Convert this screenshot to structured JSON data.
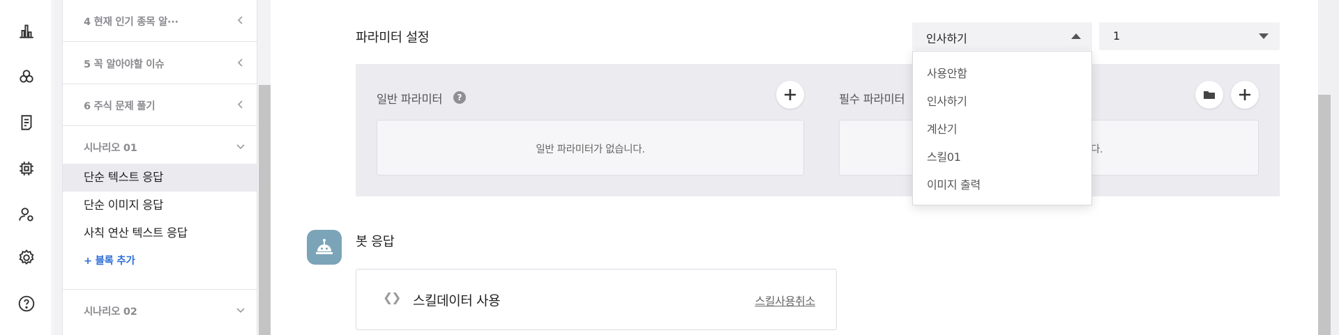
{
  "rail": {
    "icons": [
      "chart-icon",
      "shapes-icon",
      "document-icon",
      "chip-icon",
      "user-settings-icon",
      "gear-icon",
      "help-icon"
    ]
  },
  "sidebar": {
    "blocks_collapsed": [
      {
        "label": "4 현재 인기 종목 알···"
      },
      {
        "label": "5 꼭 알아야할 이슈"
      },
      {
        "label": "6 주식 문제 풀기"
      }
    ],
    "scenario1": {
      "label": "시나리오 01"
    },
    "items": [
      {
        "label": "단순 텍스트 응답"
      },
      {
        "label": "단순 이미지 응답"
      },
      {
        "label": "사칙 연산 텍스트 응답"
      }
    ],
    "add_block": "+ 블록 추가",
    "scenario2": {
      "label": "시나리오 02"
    }
  },
  "params": {
    "title": "파라미터 설정",
    "select_primary": "인사하기",
    "select_secondary": "1",
    "general_label": "일반 파라미터",
    "help_glyph": "?",
    "required_label": "필수 파라미터",
    "general_empty": "일반 파라미터가 없습니다.",
    "required_empty_tail": "다."
  },
  "dropdown": {
    "options": [
      "사용안함",
      "인사하기",
      "계산기",
      "스킬01",
      "이미지 출력"
    ]
  },
  "bot": {
    "title": "봇 응답",
    "code_glyph": "❮❯",
    "skill_title": "스킬데이터 사용",
    "cancel": "스킬사용취소"
  }
}
